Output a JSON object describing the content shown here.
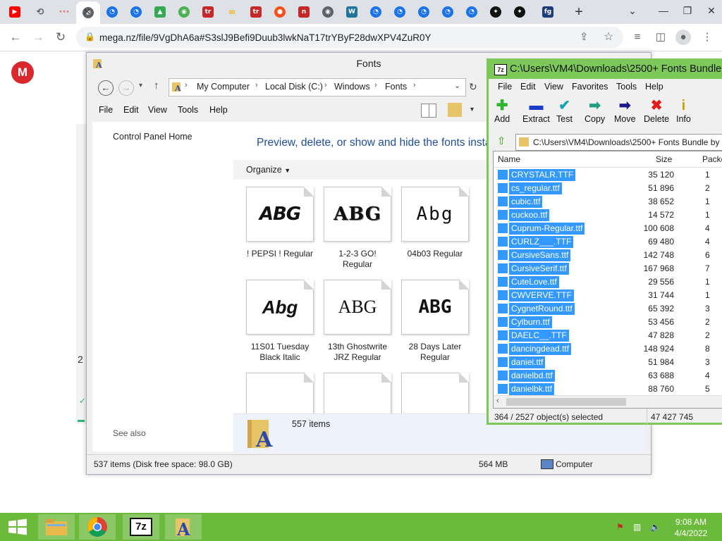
{
  "browser": {
    "active_tab_close": "✕",
    "new_tab": "+",
    "tabs": [
      {
        "icon": "youtube-icon",
        "color": "#ff0000",
        "glyph": "▶"
      },
      {
        "icon": "history-icon",
        "color": "#5f6368",
        "glyph": "⟲"
      },
      {
        "icon": "loading-icon",
        "color": "#e57373",
        "glyph": "···"
      },
      {
        "icon": "globe-icon",
        "color": "#5f6368",
        "glyph": "◉"
      },
      {
        "icon": "link-icon",
        "color": "#1a73e8",
        "glyph": "◔"
      },
      {
        "icon": "link-icon",
        "color": "#1a73e8",
        "glyph": "◔"
      },
      {
        "icon": "google-drive-icon",
        "color": "#34a853",
        "glyph": "▲"
      },
      {
        "icon": "globe-icon",
        "color": "#4caf50",
        "glyph": "◉"
      },
      {
        "icon": "tr-icon",
        "color": "#c62828",
        "glyph": "tr"
      },
      {
        "icon": "glasses-icon",
        "color": "#f4b400",
        "glyph": "∞"
      },
      {
        "icon": "tr-icon",
        "color": "#c62828",
        "glyph": "tr"
      },
      {
        "icon": "basketball-icon",
        "color": "#f4511e",
        "glyph": "●"
      },
      {
        "icon": "app-icon",
        "color": "#c62828",
        "glyph": "n"
      },
      {
        "icon": "globe-icon",
        "color": "#5f6368",
        "glyph": "◉"
      },
      {
        "icon": "wordpress-icon",
        "color": "#21759b",
        "glyph": "W"
      },
      {
        "icon": "link-icon",
        "color": "#1a73e8",
        "glyph": "◔"
      },
      {
        "icon": "link-icon",
        "color": "#1a73e8",
        "glyph": "◔"
      },
      {
        "icon": "link-icon",
        "color": "#1a73e8",
        "glyph": "◔"
      },
      {
        "icon": "link-icon",
        "color": "#1a73e8",
        "glyph": "◔"
      },
      {
        "icon": "link-icon",
        "color": "#1a73e8",
        "glyph": "◔"
      },
      {
        "icon": "swirl-icon",
        "color": "#111111",
        "glyph": "✦"
      },
      {
        "icon": "swirl-icon",
        "color": "#111111",
        "glyph": "✦"
      },
      {
        "icon": "fg-icon",
        "color": "#1c3d7a",
        "glyph": "fg"
      }
    ],
    "window_controls": {
      "minimize": "—",
      "restore": "❐",
      "close": "✕",
      "dropdown": "⌄"
    },
    "url": "mega.nz/file/9VgDhA6a#S3slJ9Befi9Duub3lwkNaT17trYByF28dwXPV4ZuR0Y",
    "mega_logo": "M"
  },
  "explorer": {
    "title": "Fonts",
    "breadcrumbs": [
      "My Computer",
      "Local Disk (C:)",
      "Windows",
      "Fonts"
    ],
    "menu": [
      "File",
      "Edit",
      "View",
      "Tools",
      "Help"
    ],
    "left_link": "Control Panel Home",
    "see_also": "See also",
    "heading": "Preview, delete, or show and hide the fonts insta",
    "organize": "Organize",
    "fonts": [
      {
        "glyph": "ABG",
        "name": "! PEPSI ! Regular"
      },
      {
        "glyph": "ABG",
        "name": "1-2-3 GO!\nRegular"
      },
      {
        "glyph": "Abg",
        "name": "04b03 Regular"
      },
      {
        "glyph": "Abg",
        "name": "11S01 Tuesday\nBlack Italic"
      },
      {
        "glyph": "ABG",
        "name": "13th Ghostwrite\nJRZ Regular"
      },
      {
        "glyph": "ABG",
        "name": "28 Days Later\nRegular"
      }
    ],
    "details_count": "557 items",
    "status_items": "537 items (Disk free space: 98.0 GB)",
    "status_size": "564 MB",
    "status_location": "Computer"
  },
  "sevenzip": {
    "title": "C:\\Users\\VM4\\Downloads\\2500+ Fonts Bundle",
    "menu": [
      "File",
      "Edit",
      "View",
      "Favorites",
      "Tools",
      "Help"
    ],
    "buttons": [
      {
        "label": "Add",
        "icon": "add-icon",
        "glyph": "✚",
        "color": "#2db52d"
      },
      {
        "label": "Extract",
        "icon": "extract-icon",
        "glyph": "▬",
        "color": "#1a3cc8"
      },
      {
        "label": "Test",
        "icon": "test-icon",
        "glyph": "✔",
        "color": "#14a4b4"
      },
      {
        "label": "Copy",
        "icon": "copy-icon",
        "glyph": "➡",
        "color": "#1e9e80"
      },
      {
        "label": "Move",
        "icon": "move-icon",
        "glyph": "➡",
        "color": "#1a1a8c"
      },
      {
        "label": "Delete",
        "icon": "delete-icon",
        "glyph": "✖",
        "color": "#e01b1b"
      },
      {
        "label": "Info",
        "icon": "info-icon",
        "glyph": "i",
        "color": "#c8a400"
      }
    ],
    "path": "C:\\Users\\VM4\\Downloads\\2500+ Fonts Bundle by S",
    "columns": {
      "name": "Name",
      "size": "Size",
      "packed": "Packe"
    },
    "files": [
      {
        "name": "CRYSTALR.TTF",
        "size": "35 120",
        "packed": "1"
      },
      {
        "name": "cs_regular.ttf",
        "size": "51 896",
        "packed": "2"
      },
      {
        "name": "cubic.ttf",
        "size": "38 652",
        "packed": "1"
      },
      {
        "name": "cuckoo.ttf",
        "size": "14 572",
        "packed": "1"
      },
      {
        "name": "Cuprum-Regular.ttf",
        "size": "100 608",
        "packed": "4"
      },
      {
        "name": "CURLZ___.TTF",
        "size": "69 480",
        "packed": "4"
      },
      {
        "name": "CursiveSans.ttf",
        "size": "142 748",
        "packed": "6"
      },
      {
        "name": "CursiveSerif.ttf",
        "size": "167 968",
        "packed": "7"
      },
      {
        "name": "CuteLove.ttf",
        "size": "29 556",
        "packed": "1"
      },
      {
        "name": "CWVERVE.TTF",
        "size": "31 744",
        "packed": "1"
      },
      {
        "name": "CygnetRound.ttf",
        "size": "65 392",
        "packed": "3"
      },
      {
        "name": "Cylburn.ttf",
        "size": "53 456",
        "packed": "2"
      },
      {
        "name": "DAELC__.TTF",
        "size": "47 828",
        "packed": "2"
      },
      {
        "name": "dancingdead.ttf",
        "size": "148 924",
        "packed": "8"
      },
      {
        "name": "daniel.ttf",
        "size": "51 984",
        "packed": "3"
      },
      {
        "name": "danielbd.ttf",
        "size": "63 688",
        "packed": "4"
      },
      {
        "name": "danielbk.ttf",
        "size": "88 760",
        "packed": "5"
      }
    ],
    "status_selected": "364 / 2527 object(s) selected",
    "status_size": "47 427 745"
  },
  "taskbar": {
    "apps": [
      {
        "name": "start-button",
        "icon": "windows-logo-icon"
      },
      {
        "name": "file-explorer-app",
        "icon": "folder-icon"
      },
      {
        "name": "chrome-app",
        "icon": "chrome-icon"
      },
      {
        "name": "sevenzip-app",
        "icon": "sevenzip-icon",
        "label": "7z"
      },
      {
        "name": "fonts-app",
        "icon": "font-folder-icon",
        "label": "A"
      }
    ],
    "time": "9:08 AM",
    "date": "4/4/2022"
  }
}
